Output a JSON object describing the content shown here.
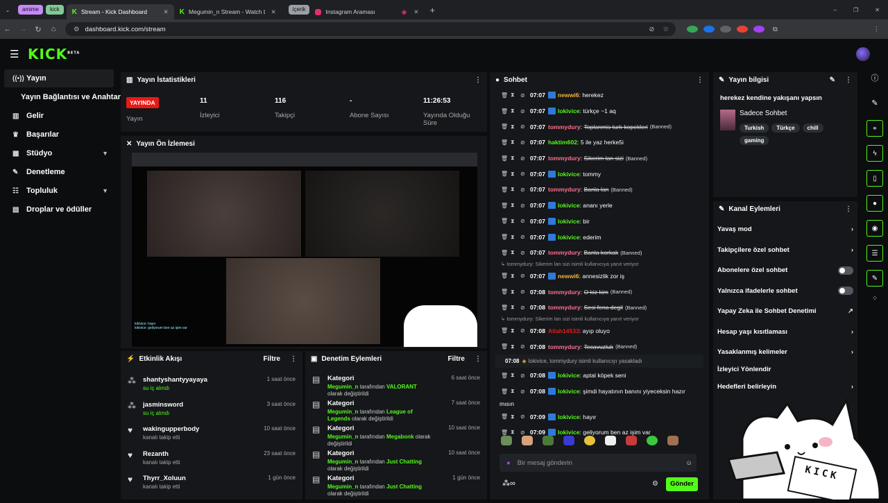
{
  "browser": {
    "chips": [
      {
        "label": "amime",
        "color": "#c58af9"
      },
      {
        "label": "kick",
        "color": "#81c995"
      },
      {
        "label": "içerik",
        "color": "#9aa0a6"
      }
    ],
    "tabs": [
      {
        "label": "Stream - Kick Dashboard"
      },
      {
        "label": "Megumin_n Stream - Watch Li"
      },
      {
        "label": "Instagram Araması"
      }
    ],
    "url": "dashboard.kick.com/stream"
  },
  "brand": {
    "logo": "KICK",
    "beta": "BETA"
  },
  "sidebar": [
    {
      "label": "Yayın",
      "icon": "broadcast-icon"
    },
    {
      "label": "Yayın Bağlantısı ve Anahtarı",
      "icon": ""
    },
    {
      "label": "Gelir",
      "icon": "chart-icon"
    },
    {
      "label": "Başarılar",
      "icon": "trophy-icon"
    },
    {
      "label": "Stüdyo",
      "icon": "grid-icon"
    },
    {
      "label": "Denetleme",
      "icon": "wrench-icon"
    },
    {
      "label": "Topluluk",
      "icon": "people-icon"
    },
    {
      "label": "Droplar ve ödüller",
      "icon": "gift-icon"
    }
  ],
  "stats": {
    "title": "Yayın İstatistikleri",
    "live_badge": "YAYINDA",
    "live_label": "Yayın",
    "viewers": "11",
    "viewers_label": "İzleyici",
    "followers": "116",
    "followers_label": "Takipçi",
    "subs": "-",
    "subs_label": "Abone Sayısı",
    "uptime": "11:26:53",
    "uptime_label": "Yayında Olduğu Süre"
  },
  "preview": {
    "title": "Yayın Ön İzlemesi",
    "chat_overlay": [
      "lokivice: hayır",
      "lokivice: geliyorum ben az işim var"
    ]
  },
  "activity": {
    "title": "Etkinlik Akışı",
    "filter": "Filtre",
    "items": [
      {
        "name": "shantyshantyyayaya",
        "sub": "su iç alındı",
        "time": "1 saat önce",
        "green": true
      },
      {
        "name": "jasminsword",
        "sub": "su iç alındı",
        "time": "3 saat önce",
        "green": true
      },
      {
        "name": "wakingupperbody",
        "sub": "kanalı takip etti",
        "time": "10 saat önce",
        "green": false
      },
      {
        "name": "Rezanth",
        "sub": "kanalı takip etti",
        "time": "23 saat önce",
        "green": false
      },
      {
        "name": "Thyrr_Xoluun",
        "sub": "kanalı takip etti",
        "time": "1 gün önce",
        "green": false
      }
    ]
  },
  "moderation": {
    "title": "Denetim Eylemleri",
    "filter": "Filtre",
    "items": [
      {
        "title": "Kategori",
        "user": "Megumin_n",
        "by": "tarafından",
        "cat": "VALORANT",
        "tail": "olarak değiştirildi",
        "time": "6 saat önce"
      },
      {
        "title": "Kategori",
        "user": "Megumin_n",
        "by": "tarafından",
        "cat": "League of Legends",
        "tail": "olarak değiştirildi",
        "time": "7 saat önce"
      },
      {
        "title": "Kategori",
        "user": "Megumin_n",
        "by": "tarafından",
        "cat": "Megabonk",
        "tail": "olarak değiştirildi",
        "time": "10 saat önce"
      },
      {
        "title": "Kategori",
        "user": "Megumin_n",
        "by": "tarafından",
        "cat": "Just Chatting",
        "tail": "olarak değiştirildi",
        "time": "10 saat önce"
      },
      {
        "title": "Kategori",
        "user": "Megumin_n",
        "by": "tarafından",
        "cat": "Just Chatting",
        "tail": "olarak değiştirildi",
        "time": "1 gün önce"
      }
    ]
  },
  "chat": {
    "title": "Sohbet",
    "colors": {
      "newwi6": "#f4b53a",
      "lokivice": "#53fc18",
      "tommydury": "#ff6f91",
      "haktim602": "#53fc18",
      "Allah14533": "#e91916"
    },
    "lines": [
      {
        "time": "07:07",
        "user": "newwi6",
        "msg": "herekez",
        "badge": true
      },
      {
        "time": "07:07",
        "user": "lokivice",
        "msg": "türkçe ~1 aq",
        "badge": true
      },
      {
        "time": "07:07",
        "user": "tommydury",
        "msg": "Toplanmis turk kopekleri",
        "banned": "(Banned)"
      },
      {
        "time": "07:07",
        "user": "haktim602",
        "msg": "5 ile yaz herke5i"
      },
      {
        "time": "07:07",
        "user": "tommydury",
        "msg": "Sikerim lan sizi",
        "banned": "(Banned)"
      },
      {
        "time": "07:07",
        "user": "lokivice",
        "msg": "tommy",
        "badge": true
      },
      {
        "time": "07:07",
        "user": "tommydury",
        "msg": "Banla lan",
        "banned": "(Banned)"
      },
      {
        "time": "07:07",
        "user": "lokivice",
        "msg": "ananı yerle",
        "badge": true
      },
      {
        "time": "07:07",
        "user": "lokivice",
        "msg": "bir",
        "badge": true
      },
      {
        "time": "07:07",
        "user": "lokivice",
        "msg": "ederim",
        "badge": true
      },
      {
        "time": "07:07",
        "user": "tommydury",
        "msg": "Banla korkak",
        "banned": "(Banned)"
      },
      {
        "reply": "tommydury: Sikerim lan sizi isimli kullanıcıya yanıt veriyor"
      },
      {
        "time": "07:07",
        "user": "newwi6",
        "msg": "annesizlik zor iş",
        "badge": true
      },
      {
        "time": "07:08",
        "user": "tommydury",
        "msg": "O kiz kim",
        "banned": "(Banned)"
      },
      {
        "time": "07:08",
        "user": "tommydury",
        "msg": "Sesi fena degil",
        "banned": "(Banned)"
      },
      {
        "reply": "tommydury: Sikerim lan sizi isimli kullanıcıya yanıt veriyor"
      },
      {
        "time": "07:08",
        "user": "Allah14533",
        "msg": "ayıp oluyo"
      },
      {
        "time": "07:08",
        "user": "tommydury",
        "msg": "Tecavuzluk",
        "banned": "(Banned)"
      },
      {
        "sys": "07:08",
        "text": "lokivice, tommydury isimli kullanıcıyı yasakladı"
      },
      {
        "time": "07:08",
        "user": "lokivice",
        "msg": "aptal köpek seni",
        "badge": true
      },
      {
        "time": "07:08",
        "user": "lokivice",
        "msg": "şimdi hayatının banını yiyeceksin hazır",
        "badge": true
      },
      {
        "cont": "mısın"
      },
      {
        "time": "07:09",
        "user": "lokivice",
        "msg": "hayır",
        "badge": true
      },
      {
        "time": "07:09",
        "user": "lokivice",
        "msg": "geliyorum ben az işim var",
        "badge": true
      }
    ],
    "placeholder": "Bir mesaj gönderin",
    "send": "Gönder"
  },
  "stream_info": {
    "title": "Yayın bilgisi",
    "stream_title": "herekez kendine yakışanı yapsın",
    "category": "Sadece Sohbet",
    "tags": [
      "Turkish",
      "Türkçe",
      "chill",
      "gaming"
    ]
  },
  "channel_actions": {
    "title": "Kanal Eylemleri",
    "items": [
      {
        "label": "Yavaş mod",
        "end": "chevron"
      },
      {
        "label": "Takipçilere özel sohbet",
        "end": "chevron"
      },
      {
        "label": "Abonelere özel sohbet",
        "end": "toggle"
      },
      {
        "label": "Yalnızca ifadelerle sohbet",
        "end": "toggle"
      },
      {
        "label": "Yapay Zeka ile Sohbet Denetimi",
        "end": "external"
      },
      {
        "label": "Hesap yaşı kısıtlaması",
        "end": "chevron"
      },
      {
        "label": "Yasaklanmış kelimeler",
        "end": "chevron"
      },
      {
        "label": "İzleyici Yönlendir",
        "end": "none"
      },
      {
        "label": "Hedefleri belirleyin",
        "end": "chevron"
      }
    ]
  },
  "overlay_text": "KICK"
}
